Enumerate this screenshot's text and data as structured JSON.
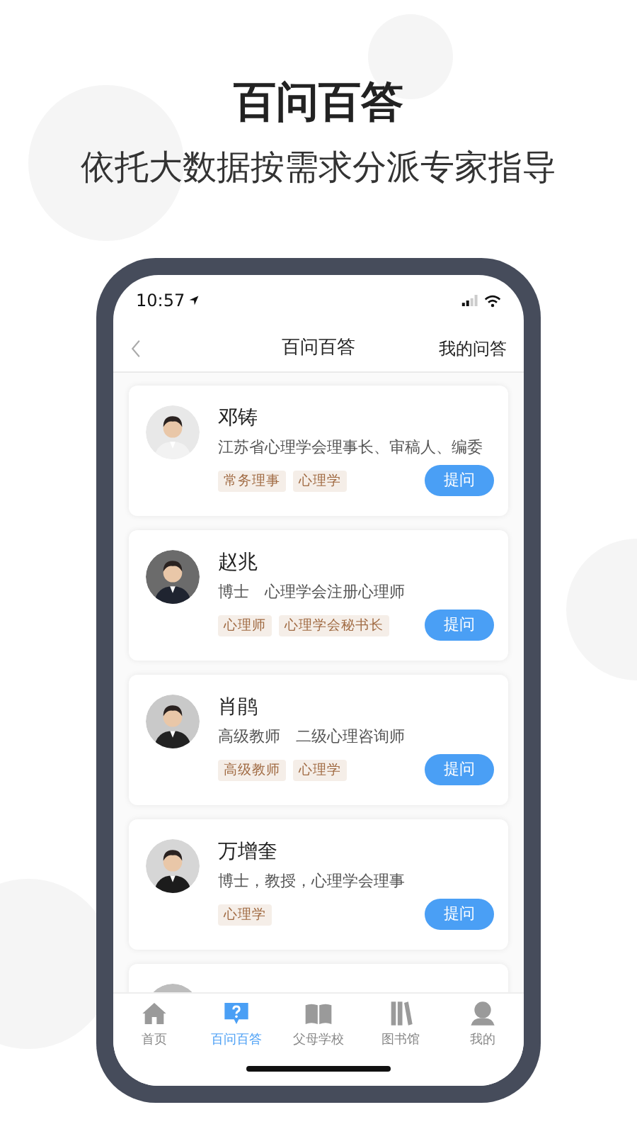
{
  "headline": "百问百答",
  "subheadline": "依托大数据按需求分派专家指导",
  "status_bar": {
    "time": "10:57"
  },
  "nav": {
    "title": "百问百答",
    "right_action": "我的问答"
  },
  "experts": [
    {
      "name": "邓铸",
      "bio": "江苏省心理学会理事长、审稿人、编委",
      "tags": [
        "常务理事",
        "心理学"
      ],
      "button": "提问"
    },
    {
      "name": "赵兆",
      "bio": "博士　心理学会注册心理师",
      "tags": [
        "心理师",
        "心理学会秘书长"
      ],
      "button": "提问"
    },
    {
      "name": "肖鹃",
      "bio": "高级教师　二级心理咨询师",
      "tags": [
        "高级教师",
        "心理学"
      ],
      "button": "提问"
    },
    {
      "name": "万增奎",
      "bio": "博士，教授，心理学会理事",
      "tags": [
        "心理学"
      ],
      "button": "提问"
    }
  ],
  "tabs": [
    {
      "label": "首页",
      "selected": false
    },
    {
      "label": "百问百答",
      "selected": true
    },
    {
      "label": "父母学校",
      "selected": false
    },
    {
      "label": "图书馆",
      "selected": false
    },
    {
      "label": "我的",
      "selected": false
    }
  ]
}
